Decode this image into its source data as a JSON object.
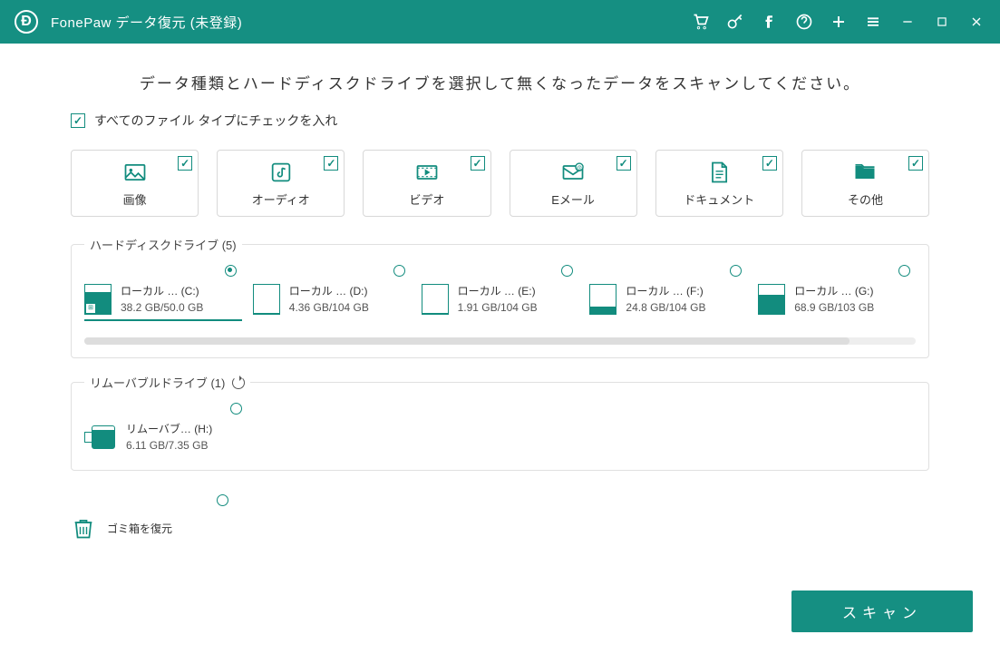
{
  "titlebar": {
    "app_name": "FonePaw データ復元 (未登録)"
  },
  "instruction": "データ種類とハードディスクドライブを選択して無くなったデータをスキャンしてください。",
  "check_all_label": "すべてのファイル タイプにチェックを入れ",
  "categories": [
    {
      "id": "image",
      "label": "画像"
    },
    {
      "id": "audio",
      "label": "オーディオ"
    },
    {
      "id": "video",
      "label": "ビデオ"
    },
    {
      "id": "email",
      "label": "Eメール"
    },
    {
      "id": "document",
      "label": "ドキュメント"
    },
    {
      "id": "other",
      "label": "その他"
    }
  ],
  "hdd_group_label": "ハードディスクドライブ (5)",
  "drives": [
    {
      "name": "ローカル … (C:)",
      "size": "38.2 GB/50.0 GB",
      "fill_pct": 76,
      "selected": true,
      "has_win": true
    },
    {
      "name": "ローカル … (D:)",
      "size": "4.36 GB/104 GB",
      "fill_pct": 4,
      "selected": false
    },
    {
      "name": "ローカル … (E:)",
      "size": "1.91 GB/104 GB",
      "fill_pct": 2,
      "selected": false
    },
    {
      "name": "ローカル … (F:)",
      "size": "24.8 GB/104 GB",
      "fill_pct": 24,
      "selected": false
    },
    {
      "name": "ローカル … (G:)",
      "size": "68.9 GB/103 GB",
      "fill_pct": 67,
      "selected": false
    }
  ],
  "removable_group_label": "リムーバブルドライブ (1)",
  "removable": [
    {
      "name": "リムーバブ… (H:)",
      "size": "6.11 GB/7.35 GB",
      "fill_pct": 83,
      "selected": false
    }
  ],
  "recycle_label": "ゴミ箱を復元",
  "scan_label": "スキャン"
}
